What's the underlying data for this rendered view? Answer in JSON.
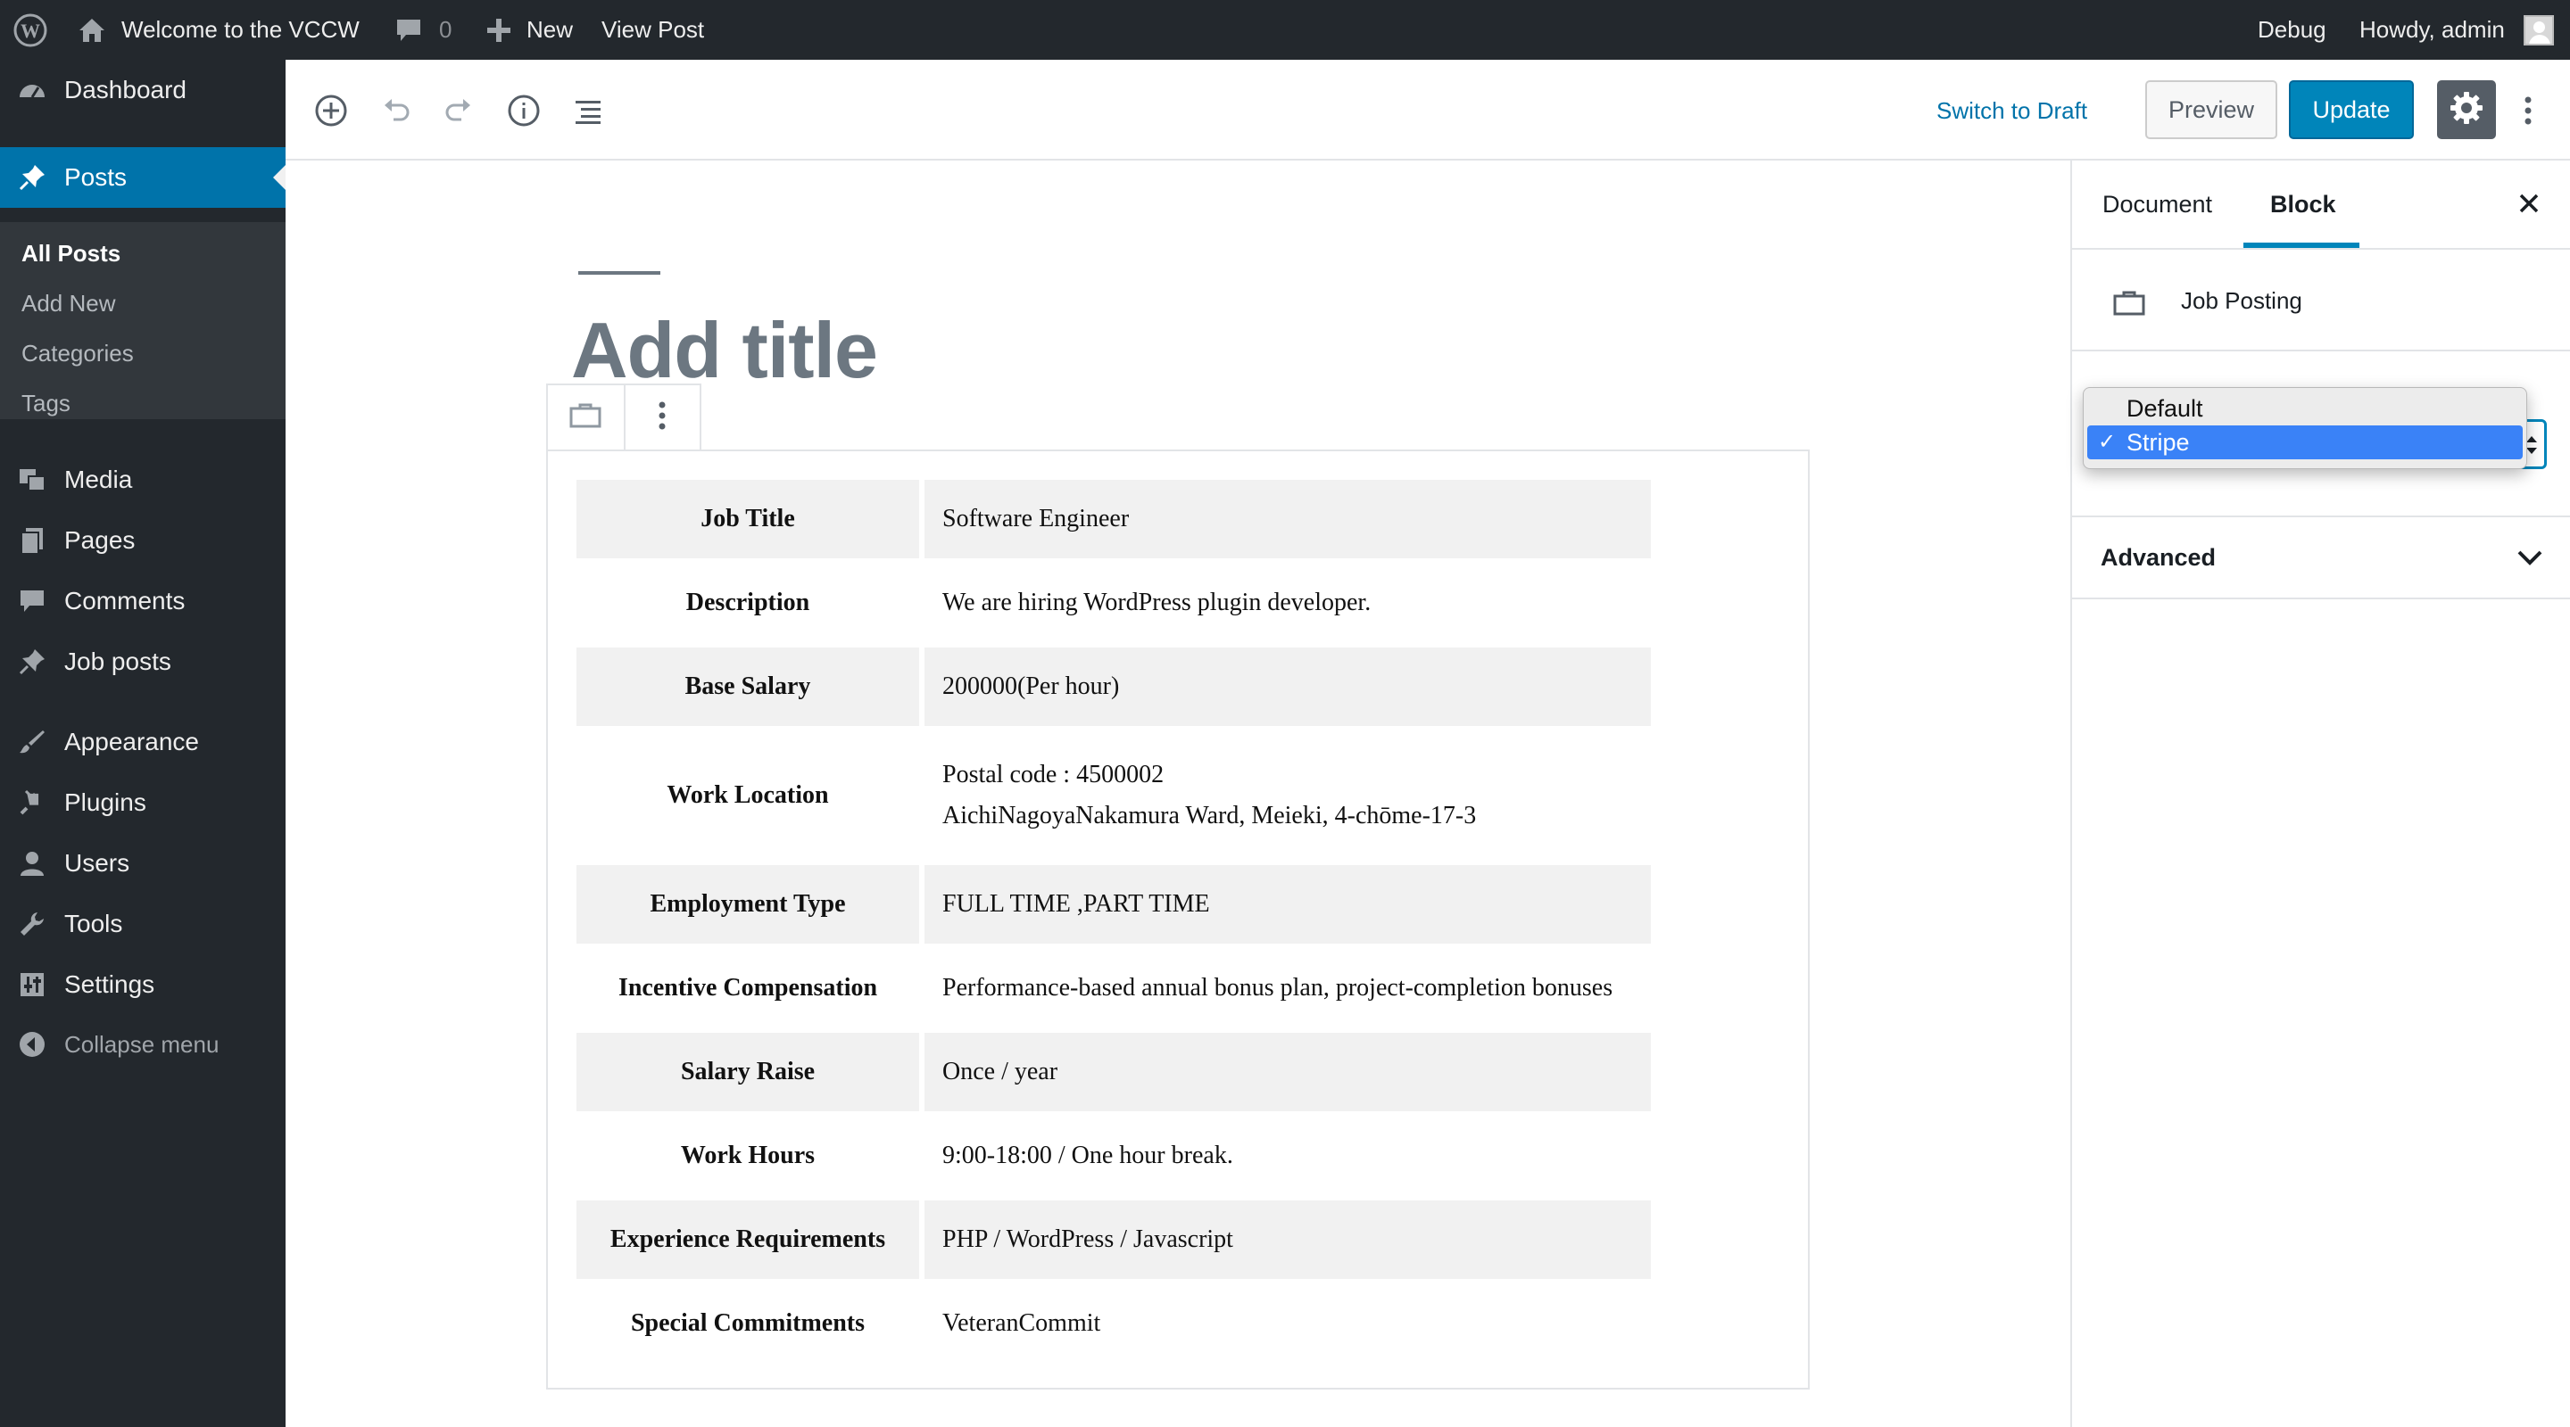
{
  "admin_bar": {
    "site_name": "Welcome to the VCCW",
    "comments_count": "0",
    "new_label": "New",
    "view_post_label": "View Post",
    "debug_label": "Debug",
    "howdy_label": "Howdy, admin"
  },
  "sidebar": {
    "dashboard": "Dashboard",
    "posts": "Posts",
    "posts_sub": [
      "All Posts",
      "Add New",
      "Categories",
      "Tags"
    ],
    "media": "Media",
    "pages": "Pages",
    "comments": "Comments",
    "job_posts": "Job posts",
    "appearance": "Appearance",
    "plugins": "Plugins",
    "users": "Users",
    "tools": "Tools",
    "settings": "Settings",
    "collapse": "Collapse menu"
  },
  "toolbar": {
    "switch_to_draft": "Switch to Draft",
    "preview": "Preview",
    "update": "Update"
  },
  "editor": {
    "title_placeholder": "Add title"
  },
  "job_table": [
    {
      "label": "Job Title",
      "value": "Software Engineer"
    },
    {
      "label": "Description",
      "value": "We are hiring WordPress plugin developer."
    },
    {
      "label": "Base Salary",
      "value": "200000(Per hour)"
    },
    {
      "label": "Work Location",
      "value": "Postal code : 4500002",
      "value2": "AichiNagoyaNakamura Ward, Meieki, 4-chōme-17-3"
    },
    {
      "label": "Employment Type",
      "value": "FULL TIME ,PART TIME"
    },
    {
      "label": "Incentive Compensation",
      "value": "Performance-based annual bonus plan, project-completion bonuses"
    },
    {
      "label": "Salary Raise",
      "value": "Once / year"
    },
    {
      "label": "Work Hours",
      "value": "9:00-18:00 / One hour break."
    },
    {
      "label": "Experience Requirements",
      "value": "PHP / WordPress / Javascript"
    },
    {
      "label": "Special Commitments",
      "value": "VeteranCommit"
    }
  ],
  "settings_panel": {
    "tab_document": "Document",
    "tab_block": "Block",
    "block_title": "Job Posting",
    "style_options": [
      "Default",
      "Stripe"
    ],
    "selected_style": "Stripe",
    "advanced_label": "Advanced"
  },
  "colors": {
    "admin_dark": "#23282d",
    "accent_blue": "#0073aa",
    "button_blue": "#0085ba",
    "stripe_gray": "#f1f1f1"
  }
}
